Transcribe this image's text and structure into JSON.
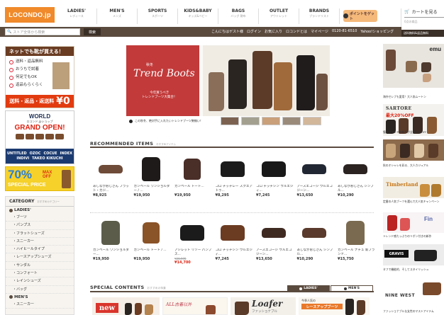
{
  "header": {
    "logo_text": "LOCONDO.jp",
    "nav": [
      {
        "main": "LADIES'",
        "sub": "レディース"
      },
      {
        "main": "MEN'S",
        "sub": "メンズ"
      },
      {
        "main": "SPORTS",
        "sub": "スポーツ"
      },
      {
        "main": "KIDS&BABY",
        "sub": "キッズ&ベビー"
      },
      {
        "main": "BAGS",
        "sub": "バッグ 財布"
      },
      {
        "main": "OUTLET",
        "sub": "アウトレット"
      },
      {
        "main": "BRANDS",
        "sub": "ブランドリスト"
      }
    ],
    "point_button": "ポイントをゲット",
    "cart_label": "カートを見る",
    "cart_sub": "0点の商品",
    "search_placeholder": "ストア全体から検索",
    "search_button": "検索",
    "util_links": [
      "こんにちはゲスト様",
      "ログイン",
      "お気に入り",
      "ロコンドとは",
      "マイページ",
      "0120-81-6510",
      "Yahoo!ショッピング"
    ],
    "shipping_bar": "送料無料&返品無料"
  },
  "left": {
    "promo1": {
      "title": "ネットでも靴が買える！",
      "items": [
        "送料・返品無料",
        "おうちで試着",
        "何足でもOK",
        "返品もらくらく"
      ],
      "bottom": "送料・返品・返送料",
      "yen": "¥0"
    },
    "promo2": {
      "world": "WORLD",
      "sub": "ロコンド.jpショップ",
      "open": "GRAND OPEN!",
      "brands": [
        "UNTITLED",
        "OZOC",
        "COCUE",
        "INDEX",
        "INDIVI",
        "TAKEO KIKUCHI"
      ]
    },
    "promo3": {
      "percent": "70%",
      "max": "MAX",
      "off": "OFF",
      "special": "SPECIAL PRICE"
    },
    "category": {
      "title": "CATEGORY",
      "title_sub": "おすすめカテゴリー",
      "ladies": "LADIES'",
      "items": [
        "ブーツ",
        "パンプス",
        "フラットシューズ",
        "スニーカー",
        "ハイヒールタイプ",
        "レースアップシューズ",
        "サンダル",
        "コンフォート",
        "レインシューズ",
        "バッグ"
      ],
      "mens": "MEN'S",
      "mens_items": [
        "スニーカー"
      ]
    }
  },
  "hero": {
    "season": "秋冬",
    "title": "Trend Boots",
    "sub1": "今年買うべき",
    "sub2": "トレンドブーツ大集合！",
    "caption": "この秋冬、絶対手に入れたいトレンドブーツ勢揃い！"
  },
  "recommended": {
    "title": "RECOMMENDED ITEMS",
    "title_sub": "おすすめアイテム",
    "row1": [
      {
        "name": "あしながおじさん フラット・カジ...",
        "price": "¥8,925",
        "color": "#6e4a38",
        "shape": "flat"
      },
      {
        "name": "カンペール ワンショルダー / ...",
        "price": "¥19,950",
        "color": "#1e1a1a",
        "shape": "bag"
      },
      {
        "name": "カンペール トート...",
        "price": "¥19,950",
        "color": "#4a2e28",
        "shape": "tote"
      },
      {
        "name": "コロ チッチレー スクエアトゥ...",
        "price": "¥8,295",
        "color": "#1b1b1b",
        "shape": "heel"
      },
      {
        "name": "コロ チッチシン ウルエジィ...",
        "price": "¥7,245",
        "color": "#181818",
        "shape": "heel"
      },
      {
        "name": "アースエコージ ウルエコジーン...",
        "price": "¥13,650",
        "color": "#222833",
        "shape": "loafer"
      },
      {
        "name": "あしながおじさん シンプル...",
        "price": "¥10,290",
        "color": "#2a2322",
        "shape": "loafer"
      }
    ],
    "row2": [
      {
        "name": "カンペール ワンショルダー...",
        "price": "¥19,950",
        "color": "#5b5c4a",
        "shape": "bag"
      },
      {
        "name": "カンペール トート / ...",
        "price": "¥19,950",
        "color": "#8a5328",
        "shape": "tote"
      },
      {
        "name": "アシレット リゾー パンプス...",
        "old": "¥20,995",
        "price": "¥14,700",
        "color": "#1b1b1b",
        "shape": "heel",
        "sale": true
      },
      {
        "name": "コロ チッチシン ウルエジィ...",
        "price": "¥7,245",
        "color": "#6b3b22",
        "shape": "heel"
      },
      {
        "name": "アースエコージ ウルエコジーン...",
        "price": "¥13,650",
        "color": "#3f2a22",
        "shape": "loafer"
      },
      {
        "name": "あしながおじさん シンプル...",
        "price": "¥10,290",
        "color": "#5a3a2c",
        "shape": "loafer"
      },
      {
        "name": "カンペール ナチュ 新ブランド...",
        "price": "¥15,750",
        "color": "#7a6a50",
        "shape": "bag"
      }
    ]
  },
  "special": {
    "title": "SPECIAL CONTENTS",
    "title_sub": "おすすめの特集",
    "tab_ladies": "LADIES'",
    "tab_mens": "MEN'S",
    "banner1": "new",
    "banner2": "ALL古着以外",
    "banner3_title": "Loafer",
    "banner3_sub": "ファッショナブル",
    "banner4_sub": "今季人気の",
    "banner4_tag": "レースアップブーツ"
  },
  "right": {
    "emu_logo": "emu",
    "cap1": "海外セレブも愛用！大人気ムートン",
    "sartore": "SARTORE",
    "sartore_off": "最大20%OFF",
    "cap2": "憧れブランドの新作が全品20%OFF",
    "cap3": "秋のオシャレを彩る、大人カジュアル",
    "timberland": "Timberland",
    "cap4": "定番の人気ブーツを選んで大人気キャンペーン",
    "fin": "Fin",
    "cap5": "トレンド感たっぷりのリボン付きの新作",
    "gravis": "GRAVIS",
    "cap6": "タフで機能的、そしてスタイリッシュ",
    "nine": "NINE WEST",
    "cap7": "ファッショナブルな女性のマストアイテム"
  }
}
